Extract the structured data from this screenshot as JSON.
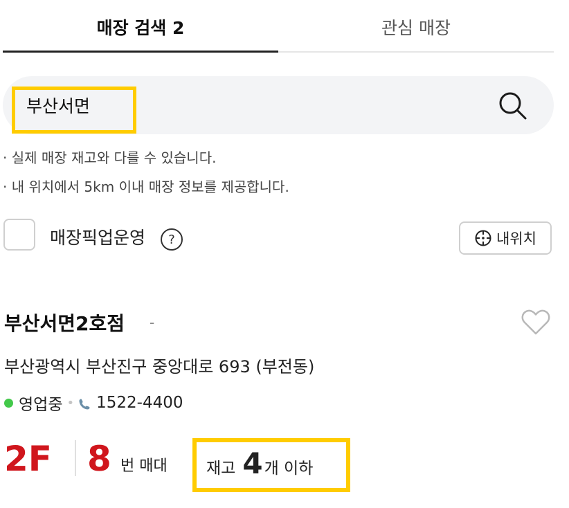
{
  "tabs": {
    "store_search": "매장 검색 2",
    "favorite_stores": "관심 매장"
  },
  "search": {
    "value": "부산서면",
    "placeholder": ""
  },
  "notes": {
    "note_1": "실제 매장 재고와 다를 수 있습니다.",
    "note_2": "내 위치에서 5km 이내 매장 정보를 제공합니다.",
    "bullet": "·"
  },
  "pickup": {
    "label": "매장픽업운영",
    "help": "?",
    "checked": false
  },
  "my_location_button": "내위치",
  "store": {
    "name": "부산서면2호점",
    "dash": "-",
    "address": "부산광역시 부산진구 중앙대로 693 (부전동)",
    "status": "영업중",
    "status_color": "#43c94a",
    "phone": "1522-4400",
    "floor": "2F",
    "shelf_number": "8",
    "shelf_label": "번 매대",
    "stock_prefix": "재고",
    "stock_count": "4",
    "stock_suffix": "개 이하"
  },
  "colors": {
    "accent_red": "#d0161d",
    "highlight_yellow": "#ffcc00"
  }
}
